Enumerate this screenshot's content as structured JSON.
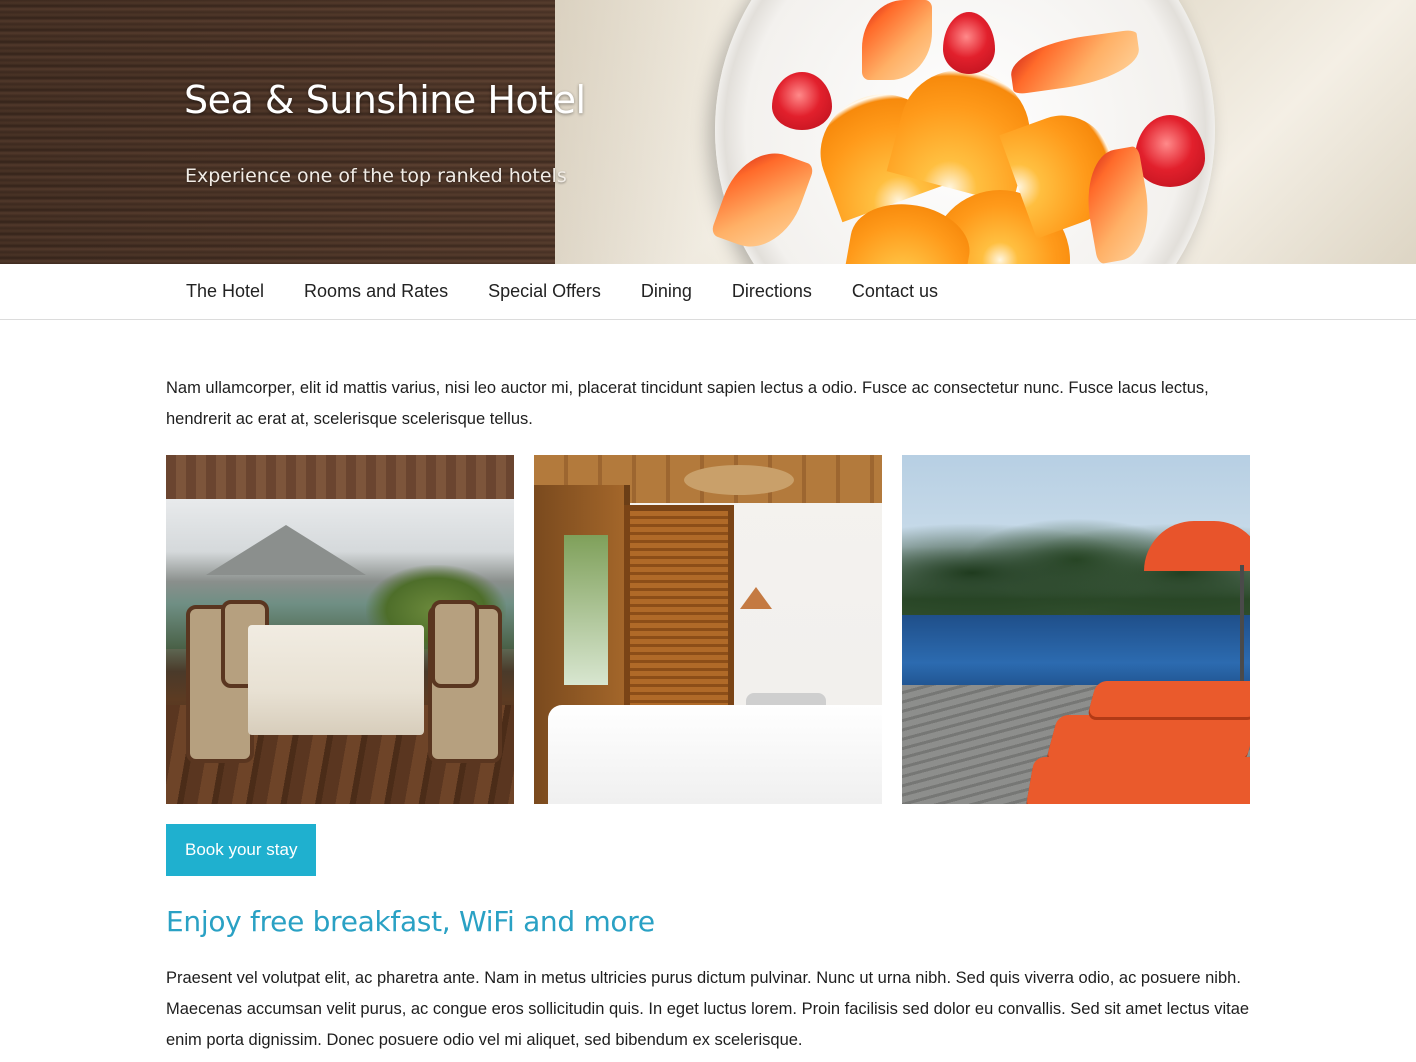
{
  "hero": {
    "title": "Sea & Sunshine Hotel",
    "subtitle": "Experience one of the top ranked hotels"
  },
  "nav": {
    "items": [
      {
        "label": "The Hotel"
      },
      {
        "label": "Rooms and Rates"
      },
      {
        "label": "Special Offers"
      },
      {
        "label": "Dining"
      },
      {
        "label": "Directions"
      },
      {
        "label": "Contact us"
      }
    ]
  },
  "main": {
    "intro": "Nam ullamcorper, elit id mattis varius, nisi leo auctor mi, placerat tincidunt sapien lectus a odio. Fusce ac consectetur nunc. Fusce lacus lectus, hendrerit ac erat at, scelerisque scelerisque tellus.",
    "book_button": "Book your stay",
    "heading": "Enjoy free breakfast, WiFi and more",
    "body": "Praesent vel volutpat elit, ac pharetra ante. Nam in metus ultricies purus dictum pulvinar. Nunc ut urna nibh. Sed quis viverra odio, ac posuere nibh. Maecenas accumsan velit purus, ac congue eros sollicitudin quis. In eget luctus lorem. Proin facilisis sed dolor eu convallis. Sed sit amet lectus vitae enim porta dignissim. Donec posuere odio vel mi aliquet, sed bibendum ex scelerisque."
  },
  "colors": {
    "accent": "#1fb0cf",
    "heading": "#2aa1c4",
    "text": "#1e1e1e"
  }
}
